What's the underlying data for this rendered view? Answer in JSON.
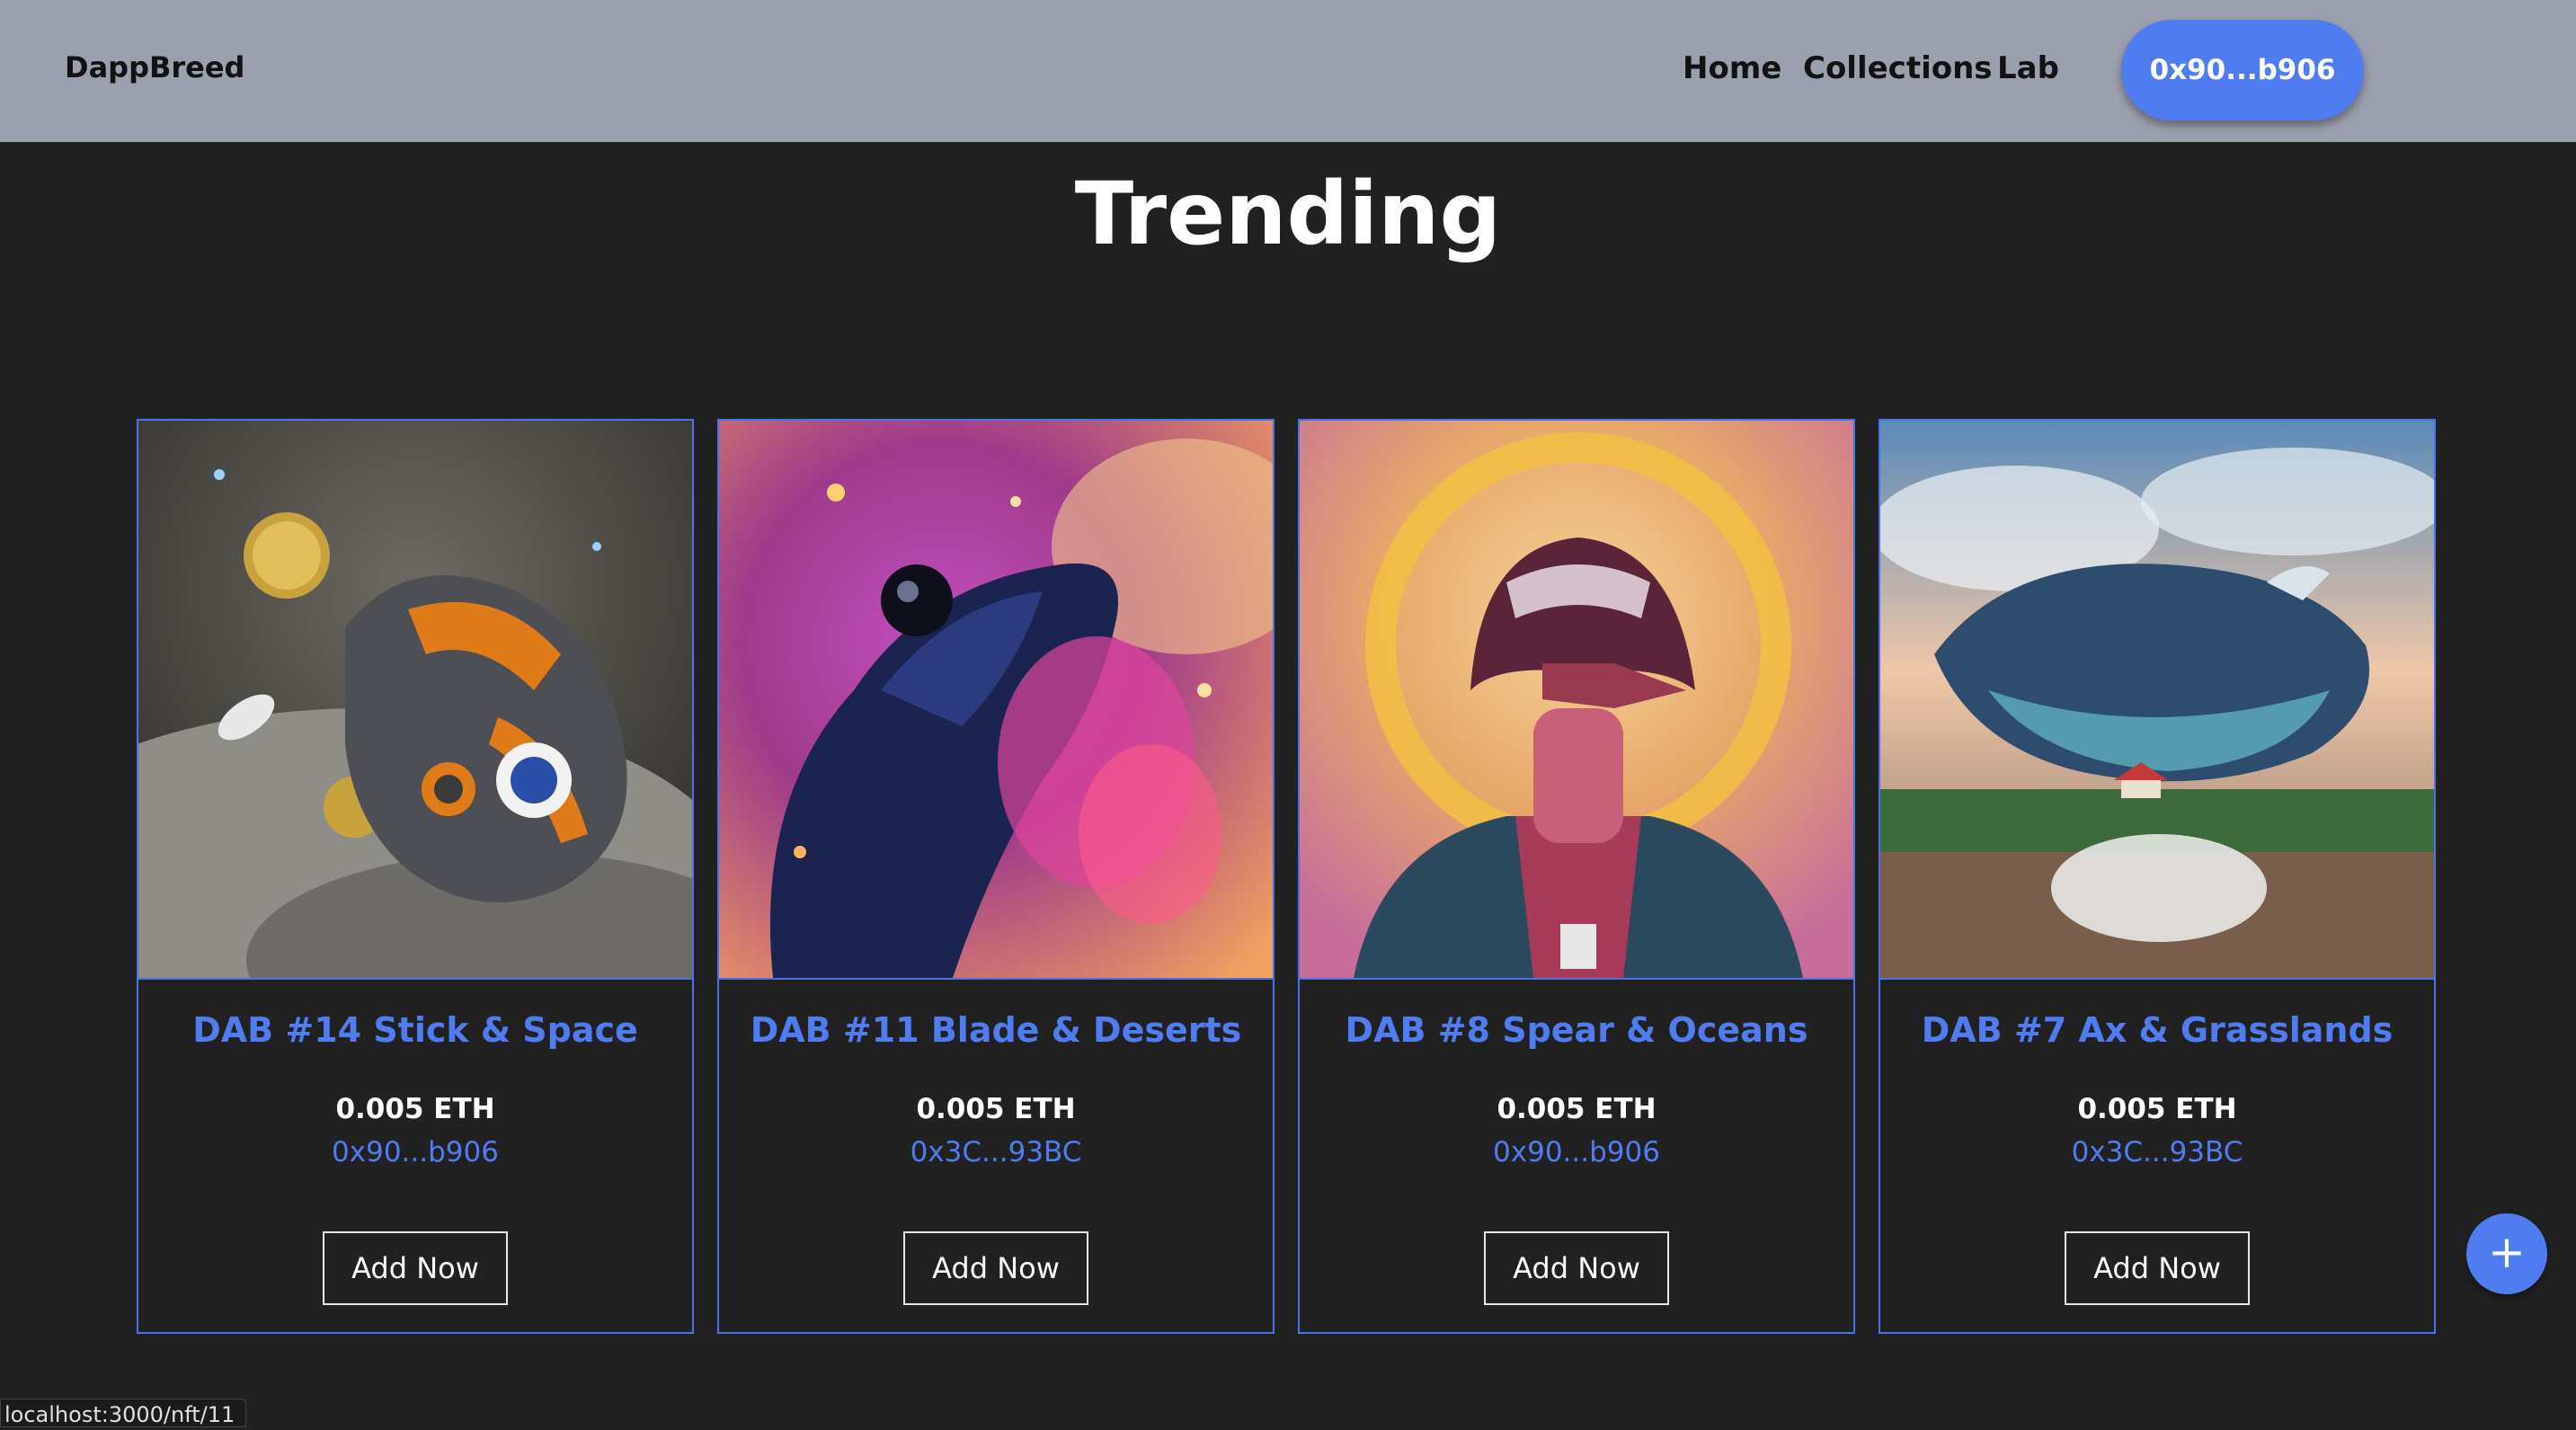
{
  "navbar": {
    "brand": "DappBreed",
    "links": [
      "Home",
      "Collections",
      "Lab"
    ],
    "wallet": "0x90...b906"
  },
  "page_title": "Trending",
  "cards": [
    {
      "name": "DAB #14 Stick & Space",
      "price": "0.005 ETH",
      "owner": "0x90...b906",
      "button": "Add Now",
      "image": "robot-helmet-moon-coins"
    },
    {
      "name": "DAB #11 Blade & Deserts",
      "price": "0.005 ETH",
      "owner": "0x3C...93BC",
      "button": "Add Now",
      "image": "cosmic-creature-nebula"
    },
    {
      "name": "DAB #8 Spear & Oceans",
      "price": "0.005 ETH",
      "owner": "0x90...b906",
      "button": "Add Now",
      "image": "vader-bird-portrait"
    },
    {
      "name": "DAB #7 Ax & Grasslands",
      "price": "0.005 ETH",
      "owner": "0x3C...93BC",
      "button": "Add Now",
      "image": "flying-whale-landscape"
    }
  ],
  "fab": "+",
  "status_url": "localhost:3000/nft/11",
  "colors": {
    "accent": "#4f7cf0",
    "background": "#212121",
    "navbar": "#9aa0ad"
  }
}
